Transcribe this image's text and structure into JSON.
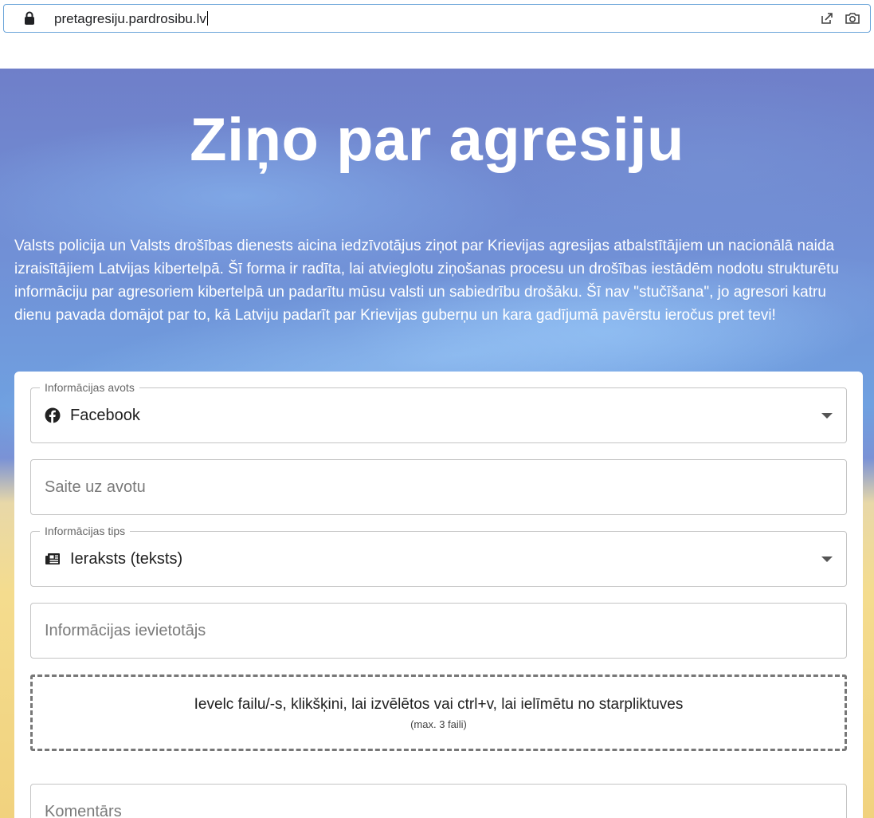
{
  "browser": {
    "url": "pretagresiju.pardrosibu.lv"
  },
  "hero": {
    "title": "Ziņo par agresiju",
    "intro": "Valsts policija un Valsts drošības dienests aicina iedzīvotājus ziņot par Krievijas agresijas atbalstītājiem un nacionālā naida izraisītājiem Latvijas kibertelpā. Šī forma ir radīta, lai atvieglotu ziņošanas procesu un drošības iestādēm nodotu strukturētu informāciju par agresoriem kibertelpā un padarītu mūsu valsti un sabiedrību drošāku. Šī nav \"stučīšana\", jo agresori katru dienu pavada domājot par to, kā Latviju padarīt par Krievijas guberņu un kara gadījumā pavērstu ieročus pret tevi!"
  },
  "form": {
    "source": {
      "label": "Informācijas avots",
      "value": "Facebook",
      "icon": "facebook-icon"
    },
    "link": {
      "placeholder": "Saite uz avotu"
    },
    "type": {
      "label": "Informācijas tips",
      "value": "Ieraksts (teksts)",
      "icon": "newspaper-icon"
    },
    "poster": {
      "placeholder": "Informācijas ievietotājs"
    },
    "upload": {
      "text": "Ievelc failu/-s, klikšķini, lai izvēlētos vai ctrl+v, lai ielīmētu no starpliktuves",
      "limit": "(max. 3 faili)"
    },
    "comment": {
      "placeholder": "Komentārs"
    }
  },
  "colors": {
    "urlbar_border": "#6aa4d9",
    "hero_blue": "#6f8fd6",
    "hero_yellow": "#f4dc8e"
  }
}
